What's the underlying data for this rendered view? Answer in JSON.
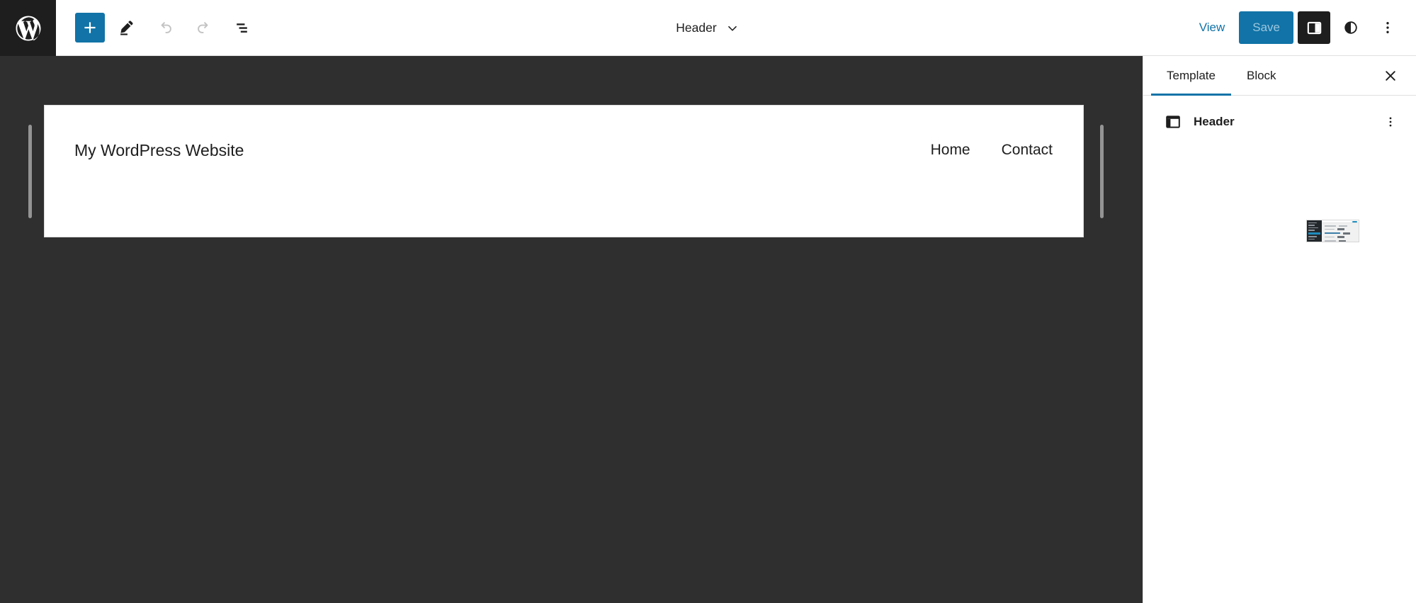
{
  "app": {
    "logo_icon": "wordpress-logo-icon",
    "background_canvas": "#2f2f2f",
    "accent": "#1173a7"
  },
  "toolbar": {
    "add_block_label": "+",
    "add_block_icon": "plus-icon",
    "tools_icon": "pencil-edit-icon",
    "undo_icon": "undo-arrow-icon",
    "redo_icon": "redo-arrow-icon",
    "list_view_icon": "list-view-icon",
    "undo_enabled": false,
    "redo_enabled": false
  },
  "document": {
    "title": "Header",
    "dropdown_icon": "chevron-down-icon"
  },
  "actions": {
    "view_label": "View",
    "save_label": "Save",
    "save_enabled": false,
    "sidebar_toggle_icon": "settings-sidebar-icon",
    "sidebar_toggle_active": true,
    "styles_icon": "contrast-half-circle-icon",
    "more_menu_icon": "three-dots-vertical-icon"
  },
  "canvas": {
    "site_title": "My WordPress Website",
    "nav_items": [
      {
        "label": "Home"
      },
      {
        "label": "Contact"
      }
    ],
    "resize_handle_left": "canvas-resize-handle-left",
    "resize_handle_right": "canvas-resize-handle-right"
  },
  "sidebar": {
    "tabs": [
      {
        "label": "Template",
        "active": true
      },
      {
        "label": "Block",
        "active": false
      }
    ],
    "close_icon": "close-x-icon",
    "block_card": {
      "icon": "template-part-icon",
      "label": "Header",
      "more_icon": "three-dots-vertical-icon"
    },
    "preview_thumbnail": "site-preview-thumbnail"
  }
}
